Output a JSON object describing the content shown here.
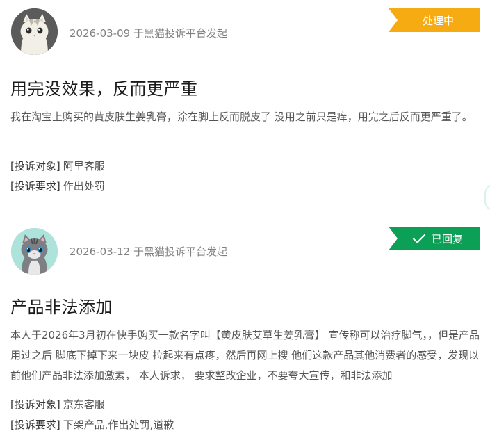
{
  "complaints": [
    {
      "date_source": "2026-03-09 于黑猫投诉平台发起",
      "status": "处理中",
      "status_color": "#f7ab13",
      "avatar_icon": "gray-cat-avatar-icon",
      "title": "用完没效果，反而更严重",
      "description": "我在淘宝上购买的黄皮肤生姜乳膏，涂在脚上反而脱皮了 没用之前只是痒，用完之后反而更严重了。",
      "target_label": "[投诉对象]",
      "target_value": "阿里客服",
      "demand_label": "[投诉要求]",
      "demand_value": "作出处罚"
    },
    {
      "date_source": "2026-03-12 于黑猫投诉平台发起",
      "status": "已回复",
      "status_color": "#0c9f56",
      "status_icon": "checkmark-icon",
      "avatar_icon": "gray-tabby-cat-avatar-icon",
      "title": "产品非法添加",
      "description": "本人于2026年3月初在快手购买一款名字叫【黄皮肤艾草生姜乳膏】 宣传称可以治疗脚气，，但是产品用过之后 脚底下掉下来一块皮 拉起来有点疼，然后再网上搜 他们这款产品其他消费者的感受，发现以前他们产品非法添加激素， 本人诉求， 要求整改企业，不要夸大宣传，和非法添加",
      "target_label": "[投诉对象]",
      "target_value": "京东客服",
      "demand_label": "[投诉要求]",
      "demand_value": "下架产品,作出处罚,道歉"
    }
  ]
}
